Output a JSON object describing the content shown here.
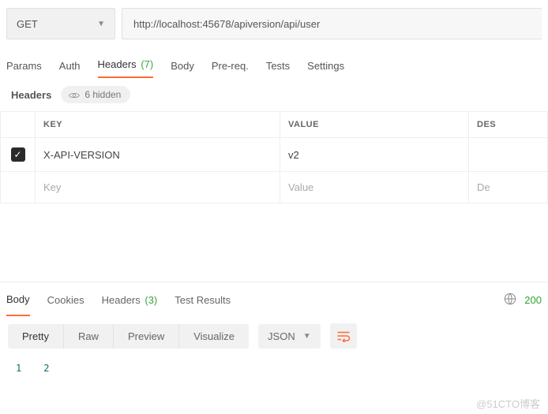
{
  "request": {
    "method": "GET",
    "url": "http://localhost:45678/apiversion/api/user"
  },
  "request_tabs": {
    "params": "Params",
    "auth": "Auth",
    "headers": "Headers",
    "headers_count": "(7)",
    "body": "Body",
    "prereq": "Pre-req.",
    "tests": "Tests",
    "settings": "Settings"
  },
  "headers_section": {
    "label": "Headers",
    "hidden_text": "6 hidden",
    "columns": {
      "key": "KEY",
      "value": "VALUE",
      "desc": "DES"
    },
    "rows": [
      {
        "checked": true,
        "key": "X-API-VERSION",
        "value": "v2",
        "desc": ""
      }
    ],
    "placeholders": {
      "key": "Key",
      "value": "Value",
      "desc": "De"
    }
  },
  "response_tabs": {
    "body": "Body",
    "cookies": "Cookies",
    "headers": "Headers",
    "headers_count": "(3)",
    "test_results": "Test Results",
    "status_code": "200"
  },
  "view_modes": {
    "pretty": "Pretty",
    "raw": "Raw",
    "preview": "Preview",
    "visualize": "Visualize",
    "type": "JSON"
  },
  "line_numbers": [
    "1",
    "2"
  ],
  "watermark": "@51CTO博客"
}
